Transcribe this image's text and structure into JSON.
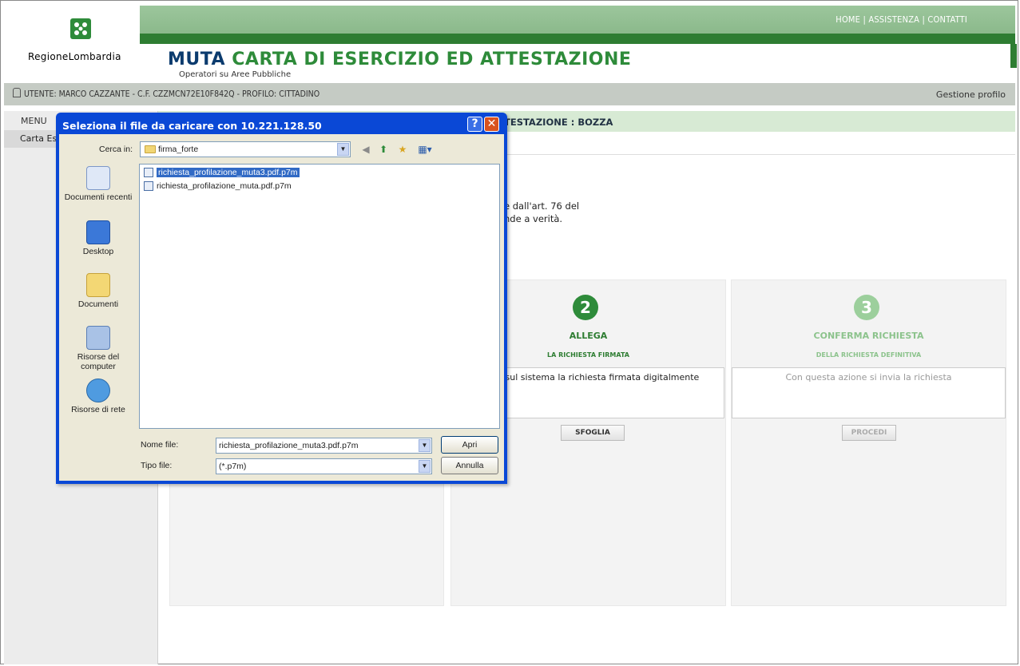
{
  "header": {
    "logo_text": "RegioneLombardia",
    "links": [
      "HOME",
      "ASSISTENZA",
      "CONTATTI"
    ],
    "link_separator": "|",
    "title_part1": "MUTA",
    "title_part2": "CARTA DI ESERCIZIO ED ATTESTAZIONE",
    "subtitle": "Operatori su Aree Pubbliche"
  },
  "userbar": {
    "user_info": "UTENTE: MARCO CAZZANTE - C.F. CZZMCN72E10F842Q - PROFILO: CITTADINO",
    "profile_link": "Gestione profilo"
  },
  "menu": {
    "label": "MENU",
    "item": "Carta Es"
  },
  "status": {
    "text": "TESTAZIONE : BOZZA"
  },
  "body": {
    "line1": "e dall'art. 76 del",
    "line2": "nde a verità."
  },
  "steps": [
    {
      "number": "2",
      "title": "ALLEGA",
      "subtitle": "LA RICHIESTA FIRMATA",
      "description": "rica sul sistema la richiesta firmata digitalmente",
      "button": "SFOGLIA"
    },
    {
      "number": "3",
      "title": "CONFERMA RICHIESTA",
      "subtitle": "DELLA RICHIESTA DEFINITIVA",
      "description": "Con questa azione si invia la richiesta",
      "button": "PROCEDI"
    }
  ],
  "dialog": {
    "title": "Seleziona il file da caricare con 10.221.128.50",
    "help": "?",
    "close": "✕",
    "lookin_label": "Cerca in:",
    "lookin_value": "firma_forte",
    "places": [
      "Documenti recenti",
      "Desktop",
      "Documenti",
      "Risorse del computer",
      "Risorse di rete"
    ],
    "files": [
      "richiesta_profilazione_muta3.pdf.p7m",
      "richiesta_profilazione_muta.pdf.p7m"
    ],
    "filename_label": "Nome file:",
    "filename_value": "richiesta_profilazione_muta3.pdf.p7m",
    "filetype_label": "Tipo file:",
    "filetype_value": "(*.p7m)",
    "open_button": "Apri",
    "cancel_button": "Annulla"
  },
  "colors": {
    "header_green": "#8bb98b",
    "dark_green": "#2e7d32",
    "title_blue": "#0b3b6e",
    "dialog_blue": "#0a48d6"
  }
}
